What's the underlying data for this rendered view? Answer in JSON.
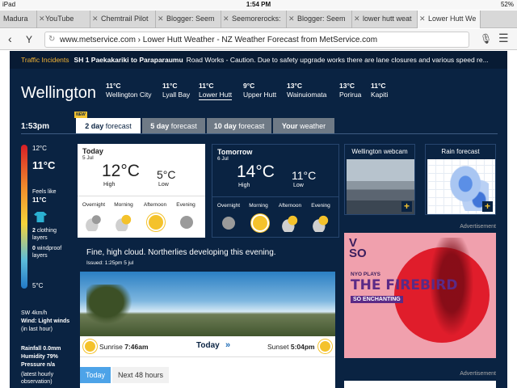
{
  "status": {
    "left": "iPad",
    "time": "1:54 PM",
    "battery": "52%"
  },
  "tabs": [
    {
      "label": "Madura"
    },
    {
      "label": "YouTube"
    },
    {
      "label": "Chemtrail Pilot"
    },
    {
      "label": "Blogger: Seem"
    },
    {
      "label": "Seemorerocks:"
    },
    {
      "label": "Blogger: Seem"
    },
    {
      "label": "lower hutt weat"
    },
    {
      "label": "Lower Hutt We"
    }
  ],
  "url": "www.metservice.com › Lower Hutt Weather - NZ Weather Forecast from MetService.com",
  "alert": {
    "title": "Traffic Incidents",
    "road": "SH 1 Paekakariki to Paraparaumu",
    "text": "Road Works - Caution. Due to safety upgrade works there are lane closures and various speed re..."
  },
  "city": "Wellington",
  "locations": [
    {
      "temp": "11°C",
      "name": "Wellington City"
    },
    {
      "temp": "11°C",
      "name": "Lyall Bay"
    },
    {
      "temp": "11°C",
      "name": "Lower Hutt"
    },
    {
      "temp": "9°C",
      "name": "Upper Hutt"
    },
    {
      "temp": "13°C",
      "name": "Wainuiomata"
    },
    {
      "temp": "13°C",
      "name": "Porirua"
    },
    {
      "temp": "11°C",
      "name": "Kapiti"
    }
  ],
  "time": "1:53pm",
  "forecast_tabs": {
    "new": "NEW",
    "t1a": "2 day",
    "t1b": " forecast",
    "t2a": "5 day",
    "t2b": " forecast",
    "t3a": "10 day",
    "t3b": " forecast",
    "t4a": "Your",
    "t4b": " weather"
  },
  "current": {
    "top": "12°C",
    "now": "11°C",
    "feels_label": "Feels like",
    "feels": "11°C",
    "clothing_n": "2",
    "clothing": " clothing layers",
    "windproof_n": "0",
    "windproof": " windproof layers",
    "bottom": "5°C",
    "wind1": "SW 4km/h",
    "wind2": "Wind: Light winds",
    "wind3": "(in last hour)",
    "rain": "Rainfall 0.0mm",
    "humidity": "Humidity 79%",
    "pressure": "Pressure n/a",
    "latest": "(latest hourly observation)"
  },
  "today": {
    "day": "Today",
    "date": "5 Jul",
    "high": "12°C",
    "low": "5°C",
    "high_label": "High",
    "low_label": "Low",
    "periods": [
      "Overnight",
      "Morning",
      "Afternoon",
      "Evening"
    ],
    "icons": [
      "cloud-moon",
      "cloud-sun",
      "sun",
      "moon"
    ]
  },
  "tomorrow": {
    "day": "Tomorrow",
    "date": "6 Jul",
    "high": "14°C",
    "low": "11°C",
    "high_label": "High",
    "low_label": "Low",
    "periods": [
      "Overnight",
      "Morning",
      "Afternoon",
      "Evening"
    ],
    "icons": [
      "moon",
      "sun",
      "cloud-sun",
      "cloud-sun"
    ]
  },
  "webcam": "Wellington webcam",
  "rainfc": "Rain forecast",
  "ad": {
    "label": "Advertisement",
    "logo1": "V",
    "logo2": "SO",
    "nyo": "NYO PLAYS",
    "title": "THE FIREBIRD",
    "sub": "SO ENCHANTING"
  },
  "summary": {
    "text": "Fine, high cloud. Northerlies developing this evening.",
    "issued": "Issued: 1:25pm 5 jul"
  },
  "sun": {
    "sunrise_label": "Sunrise",
    "sunrise": "7:46am",
    "today": "Today",
    "arrow": "»",
    "sunset_label": "Sunset",
    "sunset": "5:04pm"
  },
  "bottomtabs": [
    "Today",
    "Next 48 hours"
  ],
  "colors": {
    "navy": "#0a2342",
    "accent": "#4da3e8",
    "gold": "#f2c230"
  }
}
